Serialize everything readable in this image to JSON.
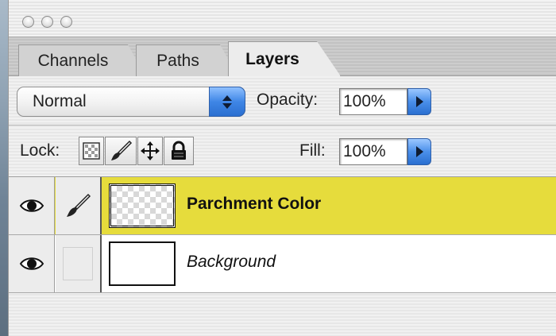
{
  "window": {
    "traffic_lights": [
      "close",
      "minimize",
      "zoom"
    ]
  },
  "tabs": [
    {
      "label": "Channels",
      "active": false
    },
    {
      "label": "Paths",
      "active": false
    },
    {
      "label": "Layers",
      "active": true
    }
  ],
  "blend": {
    "mode": "Normal"
  },
  "opacity": {
    "label": "Opacity:",
    "value": "100%"
  },
  "lock": {
    "label": "Lock:",
    "icons": [
      "lock-transparency-icon",
      "lock-paint-brush-icon",
      "lock-position-move-icon",
      "lock-all-padlock-icon"
    ]
  },
  "fill": {
    "label": "Fill:",
    "value": "100%"
  },
  "layers": [
    {
      "name": "Parchment Color",
      "selected": true,
      "visible": true,
      "thumb": "transparent"
    },
    {
      "name": "Background",
      "selected": false,
      "visible": true,
      "thumb": "white"
    }
  ],
  "colors": {
    "selection": "#e6dc3c",
    "accent_blue": "#3f86e6"
  }
}
